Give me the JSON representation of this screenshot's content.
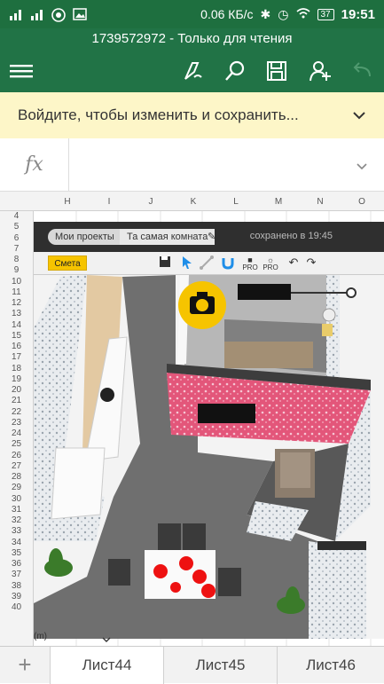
{
  "status_bar": {
    "speed": "0.06 КБ/с",
    "battery": "37",
    "time": "19:51"
  },
  "title": "1739572972 - Только для чтения",
  "toolbar": {
    "icons": [
      "menu-icon",
      "draw-icon",
      "search-icon",
      "save-icon",
      "share-user-icon",
      "undo-icon"
    ]
  },
  "banner": {
    "text": "Войдите, чтобы изменить и сохранить..."
  },
  "formula_bar": {
    "fx": "fx",
    "value": ""
  },
  "columns": [
    "H",
    "I",
    "J",
    "K",
    "L",
    "M",
    "N",
    "O"
  ],
  "rows": [
    "4",
    "5",
    "6",
    "7",
    "8",
    "9",
    "10",
    "11",
    "12",
    "13",
    "14",
    "15",
    "16",
    "17",
    "18",
    "19",
    "20",
    "21",
    "22",
    "23",
    "24",
    "25",
    "26",
    "27",
    "28",
    "29",
    "30",
    "31",
    "32",
    "33",
    "34",
    "35",
    "36",
    "37",
    "38",
    "39",
    "40"
  ],
  "embedded_app": {
    "breadcrumb_1": "Мои проекты",
    "breadcrumb_2": "Та самая комната",
    "saved_text": "сохранено в 19:45",
    "smeta_button": "Смета",
    "pro_label_1": "PRO",
    "pro_label_2": "PRO",
    "unit_label": "(m)"
  },
  "sheets": [
    {
      "name": "Лист44",
      "active": true
    },
    {
      "name": "Лист45",
      "active": false
    },
    {
      "name": "Лист46",
      "active": false
    }
  ],
  "colors": {
    "excel_green": "#217346",
    "status_green": "#1e6f3f",
    "banner_yellow": "#fdf6c8",
    "smeta_yellow": "#f6c400",
    "camera_yellow": "#f6c400",
    "pink_wall": "#e8587a",
    "floor_gray": "#7a7a7a"
  }
}
